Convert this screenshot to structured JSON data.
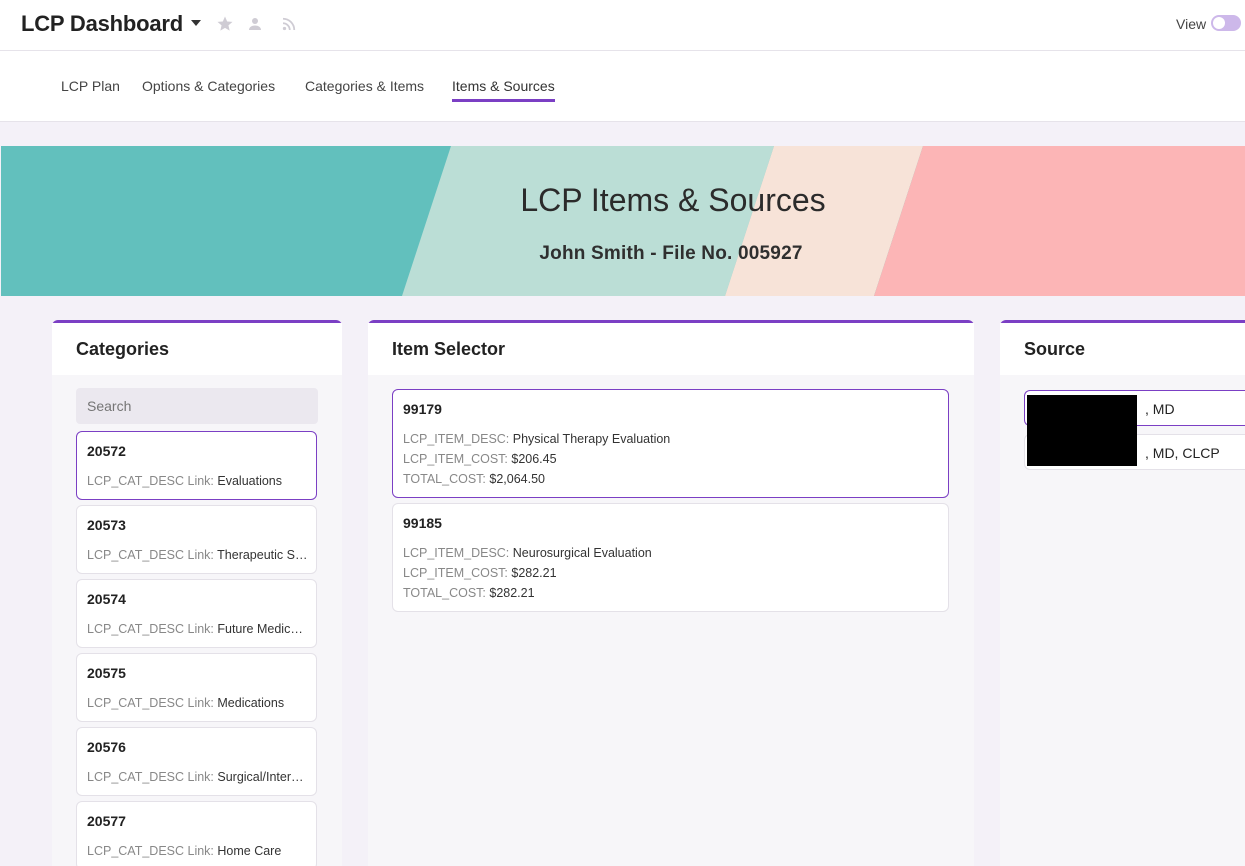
{
  "header": {
    "app_title": "LCP Dashboard",
    "icons": [
      "chevron-down-icon",
      "star-icon",
      "person-icon",
      "rss-icon"
    ],
    "view_label": "View",
    "view_toggle_on": false
  },
  "tabs": [
    {
      "label": "LCP Plan",
      "active": false
    },
    {
      "label": "Options & Categories",
      "active": false
    },
    {
      "label": "Categories & Items",
      "active": false
    },
    {
      "label": "Items & Sources",
      "active": true
    }
  ],
  "banner": {
    "title": "LCP Items & Sources",
    "subtitle": "John Smith - File No. 005927",
    "colors": [
      "#62c0bd",
      "#bbded6",
      "#f7e3d8",
      "#fcb5b6"
    ]
  },
  "categories": {
    "title": "Categories",
    "search_placeholder": "Search",
    "link_key": "LCP_CAT_DESC Link:",
    "items": [
      {
        "id": "20572",
        "desc": "Evaluations",
        "selected": true
      },
      {
        "id": "20573",
        "desc": "Therapeutic Ser...",
        "selected": false
      },
      {
        "id": "20574",
        "desc": "Future Medical ...",
        "selected": false
      },
      {
        "id": "20575",
        "desc": "Medications",
        "selected": false
      },
      {
        "id": "20576",
        "desc": "Surgical/Interve...",
        "selected": false
      },
      {
        "id": "20577",
        "desc": "Home Care",
        "selected": false
      }
    ]
  },
  "item_selector": {
    "title": "Item Selector",
    "keys": {
      "desc": "LCP_ITEM_DESC:",
      "cost": "LCP_ITEM_COST:",
      "total": "TOTAL_COST:"
    },
    "items": [
      {
        "id": "99179",
        "desc": "Physical Therapy Evaluation",
        "cost": "$206.45",
        "total": "$2,064.50",
        "selected": true
      },
      {
        "id": "99185",
        "desc": "Neurosurgical Evaluation",
        "cost": "$282.21",
        "total": "$282.21",
        "selected": false
      }
    ]
  },
  "source": {
    "title": "Source",
    "items": [
      {
        "label": ", MD",
        "selected": true
      },
      {
        "label": ", MD, CLCP",
        "selected": false
      }
    ]
  },
  "colors": {
    "accent": "#7b3fc4"
  }
}
